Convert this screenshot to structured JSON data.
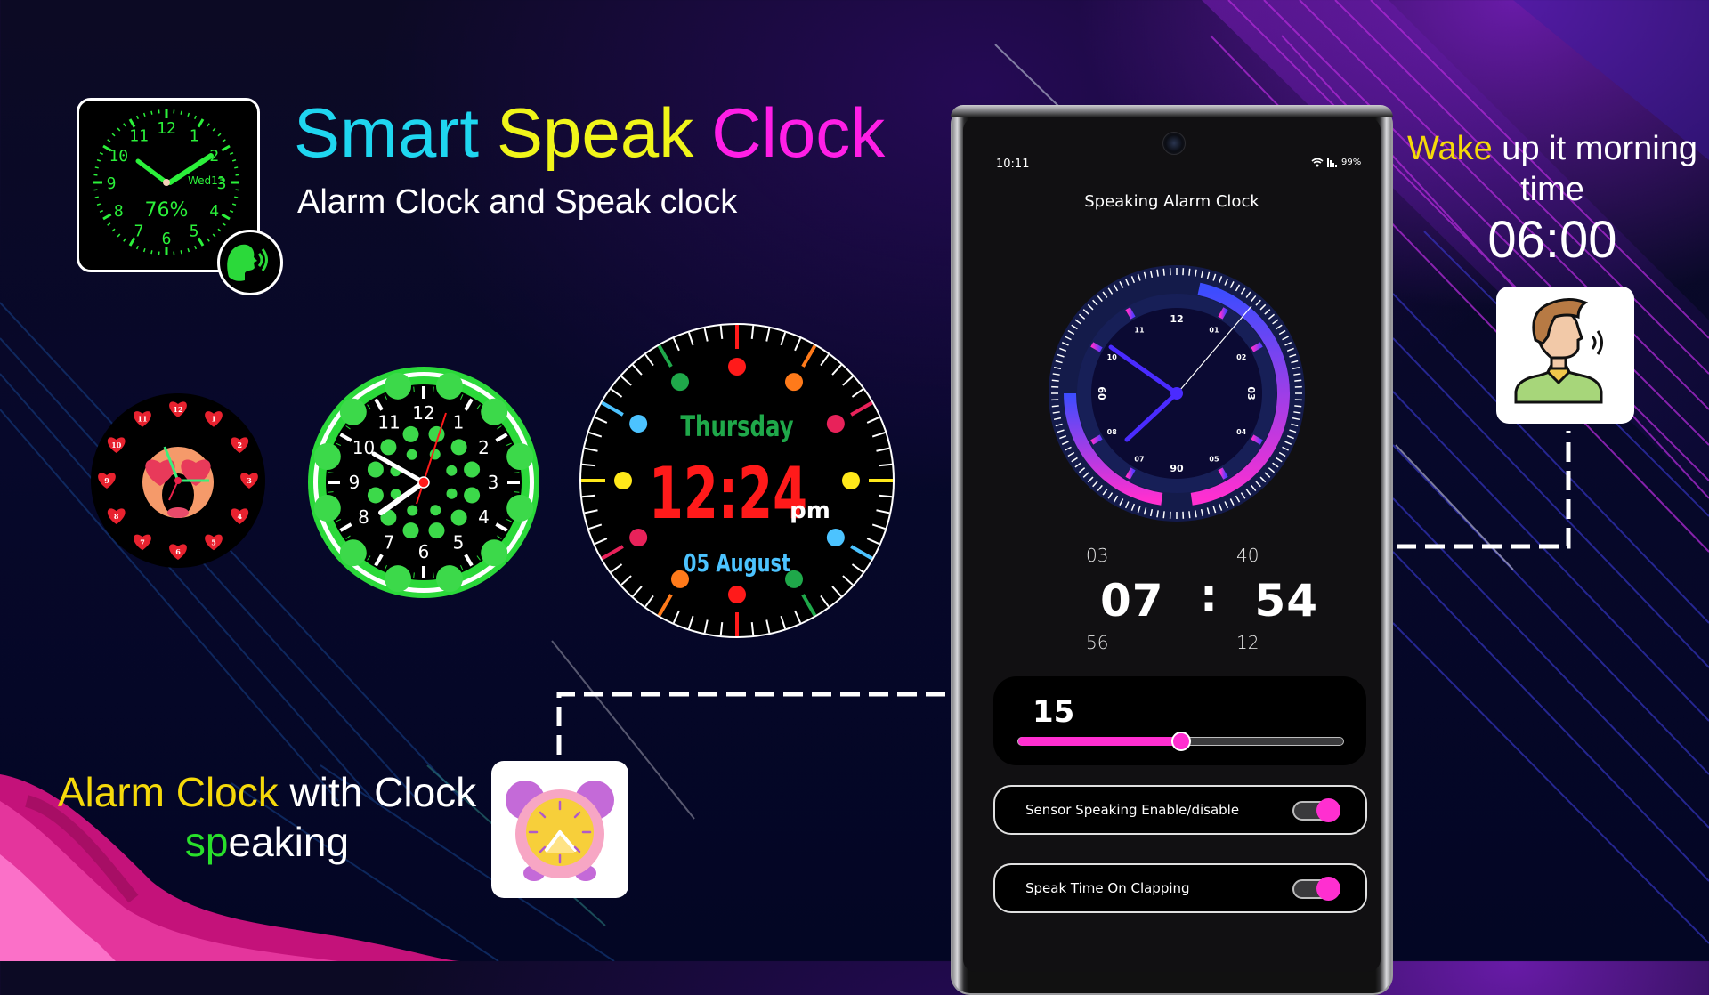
{
  "banner": {
    "title_words": [
      {
        "text": "Smart",
        "color": "#1fd6f0"
      },
      {
        "text": "Speak",
        "color": "#f0f51a"
      },
      {
        "text": "Clock",
        "color": "#ff1fe6"
      }
    ],
    "subtitle": "Alarm Clock and Speak clock"
  },
  "app_icon": {
    "date": "Wed13",
    "battery": "76%",
    "numerals": [
      "12",
      "1",
      "2",
      "3",
      "4",
      "5",
      "6",
      "7",
      "8",
      "9",
      "10",
      "11"
    ],
    "accent": "#2bf03a"
  },
  "heart_clock": {
    "numerals": [
      "12",
      "1",
      "2",
      "3",
      "4",
      "5",
      "6",
      "7",
      "8",
      "9",
      "10",
      "11"
    ]
  },
  "green_clock": {
    "numerals": [
      "12",
      "1",
      "2",
      "3",
      "4",
      "5",
      "6",
      "7",
      "8",
      "9",
      "10",
      "11"
    ]
  },
  "color_clock": {
    "day": "Thursday",
    "time": "12:24",
    "ampm": "pm",
    "date": "05 August",
    "day_color": "#1fa84a",
    "time_color": "#ff1a1a",
    "date_color": "#4cc3ff"
  },
  "phone": {
    "status_time": "10:11",
    "battery": "99%",
    "app_title": "Speaking Alarm Clock",
    "analog": {
      "labels": [
        "12",
        "01",
        "02",
        "03",
        "04",
        "05",
        "06",
        "07",
        "08",
        "09",
        "10",
        "11"
      ]
    },
    "picker": {
      "hour_prev": "03",
      "minute_prev": "40",
      "hour": "07",
      "separator": ":",
      "minute": "54",
      "hour_next": "56",
      "minute_next": "12"
    },
    "slider": {
      "value": "15",
      "fraction": 0.5
    },
    "toggles": [
      {
        "label": "Sensor Speaking Enable/disable",
        "on": true
      },
      {
        "label": "Speak Time On Clapping",
        "on": true
      }
    ],
    "accent": "#ff2fd0"
  },
  "wake_callout": {
    "highlight": "Wake",
    "rest_line1": " up it morning",
    "line2": "time",
    "time": "06:00",
    "highlight_color": "#f5d90a"
  },
  "alarm_callout": {
    "highlight": "Alarm Clock",
    "rest_line1": " with Clock",
    "line2_highlight": "sp",
    "line2_rest": "eaking",
    "highlight_color": "#f5d90a",
    "line2_color": "#29e02b"
  }
}
